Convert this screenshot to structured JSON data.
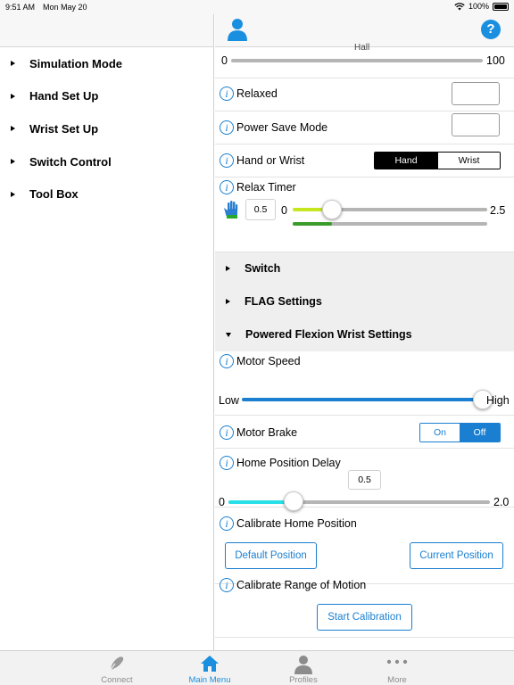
{
  "status_bar": {
    "time": "9:51 AM",
    "date": "Mon May 20",
    "battery": "100%"
  },
  "left_menu": {
    "items": [
      {
        "label": "Simulation Mode"
      },
      {
        "label": "Hand Set Up"
      },
      {
        "label": "Wrist Set Up"
      },
      {
        "label": "Switch Control"
      },
      {
        "label": "Tool Box"
      }
    ]
  },
  "top_slider": {
    "partial_label": "Hall",
    "min_label": "0",
    "max_label": "100",
    "value": 0
  },
  "relaxed": {
    "label": "Relaxed"
  },
  "power_save": {
    "label": "Power Save Mode"
  },
  "hand_or_wrist": {
    "label": "Hand or Wrist",
    "options": [
      "Hand",
      "Wrist"
    ],
    "selected": "Hand"
  },
  "relax_timer": {
    "label": "Relax Timer",
    "value_display": "0.5",
    "min_label": "0",
    "max_label": "2.5",
    "value": 0.5,
    "max": 2.5,
    "progress": 0.2
  },
  "sections": {
    "switch": "Switch",
    "flag": "FLAG Settings",
    "powered_flexion": "Powered Flexion Wrist Settings"
  },
  "motor_speed": {
    "label": "Motor Speed",
    "min_label": "Low",
    "max_label": "High",
    "value_fraction": 1.0
  },
  "motor_brake": {
    "label": "Motor Brake",
    "options": [
      "On",
      "Off"
    ],
    "selected": "Off"
  },
  "home_position_delay": {
    "label": "Home Position Delay",
    "value_display": "0.5",
    "min_label": "0",
    "max_label": "2.0",
    "value": 0.5,
    "max": 2.0
  },
  "calibrate_home": {
    "label": "Calibrate Home Position",
    "default_button": "Default Position",
    "current_button": "Current Position"
  },
  "calibrate_range": {
    "label": "Calibrate Range of Motion",
    "start_button": "Start Calibration"
  },
  "tab_bar": {
    "tabs": [
      {
        "label": "Connect",
        "icon": "connect-icon"
      },
      {
        "label": "Main Menu",
        "icon": "home-icon"
      },
      {
        "label": "Profiles",
        "icon": "profile-icon"
      },
      {
        "label": "More",
        "icon": "more-icon"
      }
    ],
    "active": "Main Menu"
  },
  "colors": {
    "accent": "#1a8fe0",
    "relax_track": "#c6e620",
    "relax_progress": "#3a9b2a",
    "delay_track": "#29e0e8",
    "speed_track": "#1a7fd0"
  }
}
